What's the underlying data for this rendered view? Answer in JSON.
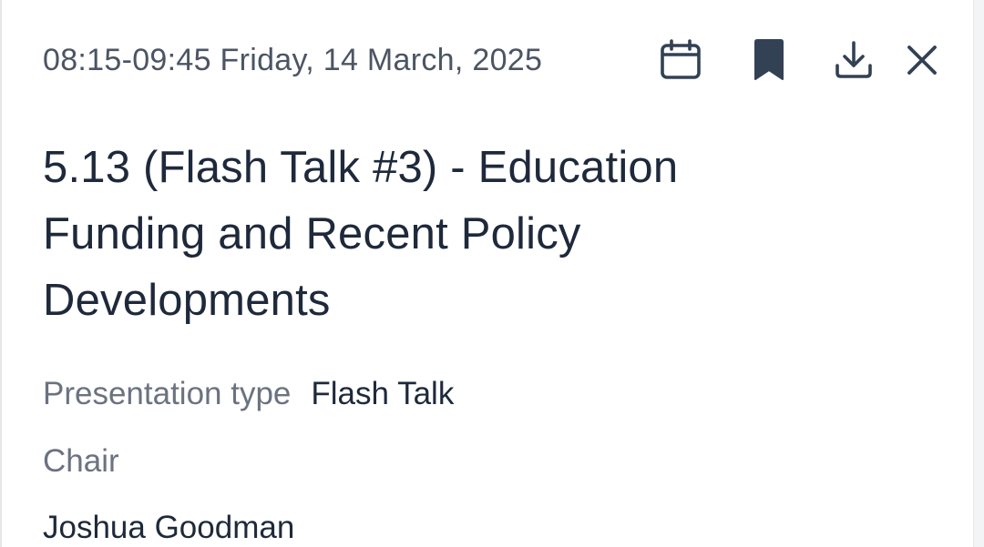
{
  "session": {
    "datetime": "08:15-09:45 Friday, 14 March, 2025",
    "title": "5.13 (Flash Talk #3) - Education Funding and Recent Policy Developments",
    "presentation_type_label": "Presentation type",
    "presentation_type_value": "Flash Talk",
    "chair_label": "Chair",
    "chair_name": "Joshua Goodman"
  },
  "actions": {
    "calendar_icon": "calendar-icon",
    "bookmark_icon": "bookmark-icon",
    "download_icon": "download-icon",
    "close_icon": "close-icon"
  },
  "colors": {
    "text_primary": "#1e293b",
    "text_secondary": "#6b7280",
    "icon_color": "#334155"
  }
}
